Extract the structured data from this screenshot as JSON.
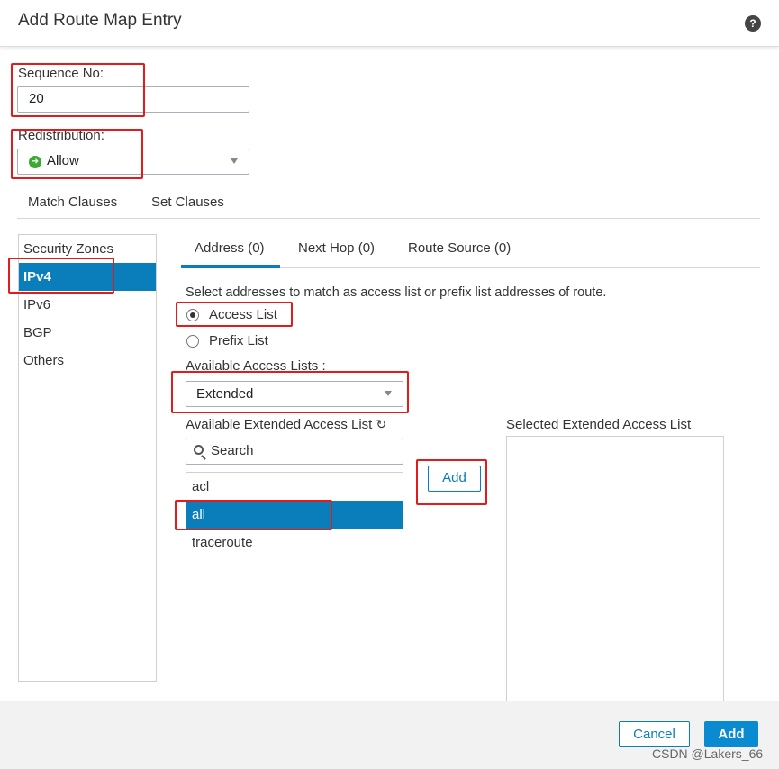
{
  "dialog": {
    "title": "Add Route Map Entry",
    "help_icon": "?"
  },
  "sequence": {
    "label": "Sequence No:",
    "value": "20"
  },
  "redistribution": {
    "label": "Redistribution:",
    "value": "Allow",
    "icon": "allow-icon"
  },
  "clause_tabs": [
    "Match Clauses",
    "Set Clauses"
  ],
  "left_nav": [
    "Security Zones",
    "IPv4",
    "IPv6",
    "BGP",
    "Others"
  ],
  "sub_tabs": [
    "Address (0)",
    "Next Hop (0)",
    "Route Source (0)"
  ],
  "address": {
    "description": "Select addresses to match as access list or prefix list addresses of route.",
    "options": [
      "Access List",
      "Prefix List"
    ],
    "selected_option": "Access List",
    "available_lists_label": "Available Access Lists :",
    "available_lists_value": "Extended",
    "available_extended_label": "Available Extended Access List",
    "refresh_icon": "↻",
    "search_placeholder": "Search",
    "items": [
      "acl",
      "all",
      "traceroute"
    ],
    "selected_item": "all",
    "add_button": "Add",
    "selected_label": "Selected Extended Access List"
  },
  "footer": {
    "cancel": "Cancel",
    "add": "Add"
  },
  "watermark": "CSDN @Lakers_66",
  "colors": {
    "accent": "#0a7dbb",
    "highlight": "#e31b1b",
    "allow_green": "#3aaa35"
  }
}
